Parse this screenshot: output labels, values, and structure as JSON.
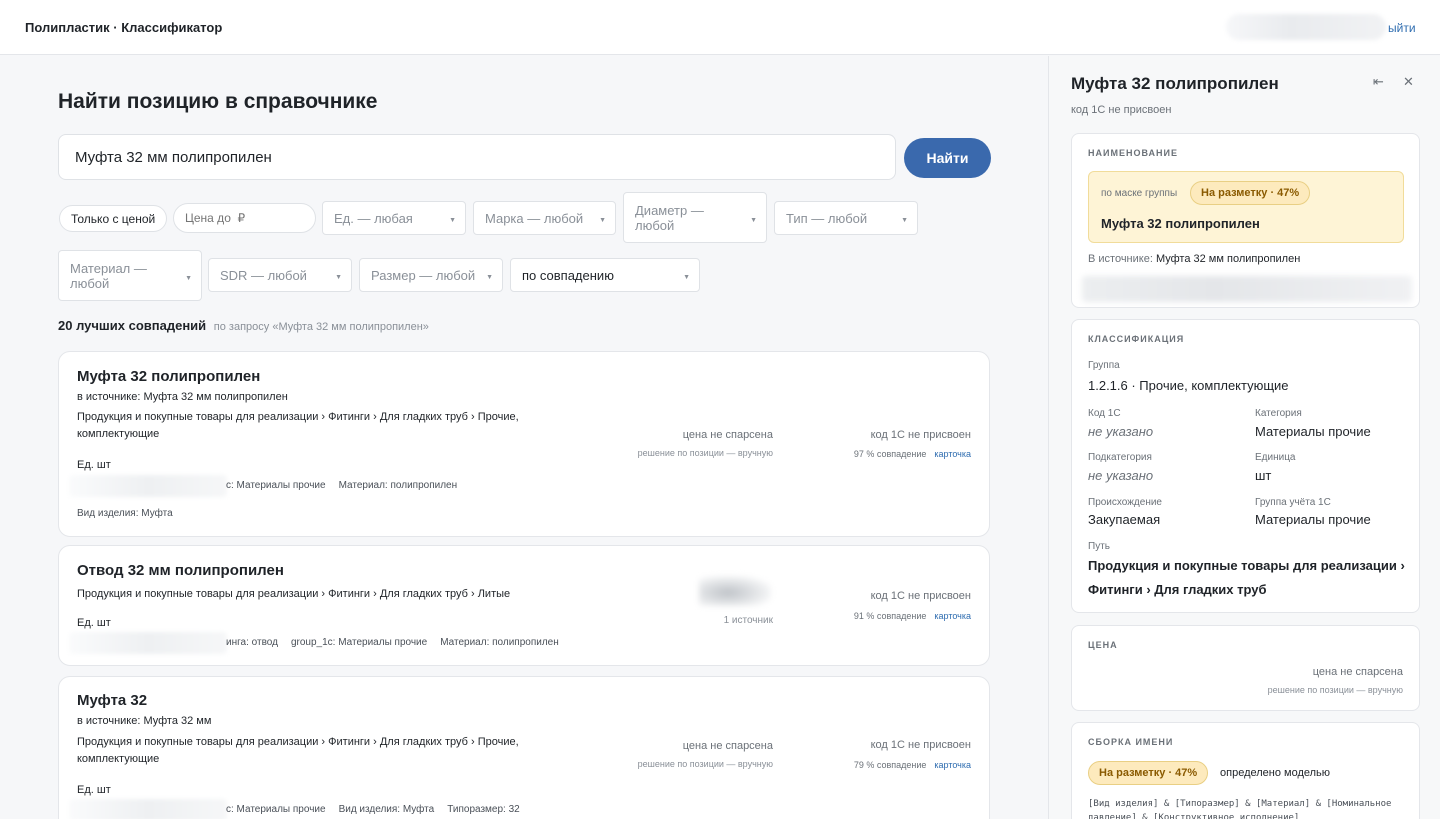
{
  "topbar": {
    "brand": "Полипластик · Классификатор",
    "logout": "ыйти"
  },
  "search": {
    "title": "Найти позицию в справочнике",
    "query": "Муфта 32 мм полипропилен",
    "button": "Найти"
  },
  "filters": {
    "only_with_price": "Только с ценой",
    "price_to_placeholder": "Цена до  ₽",
    "unit": "Ед. — любая",
    "brand": "Марка — любой",
    "diameter": "Диаметр — любой",
    "type": "Тип — любой",
    "material": "Материал — любой",
    "sdr": "SDR — любой",
    "size": "Размер — любой",
    "sort": "по совпадению"
  },
  "results": {
    "count_label": "20 лучших совпадений",
    "query_label": "по запросу «Муфта 32 мм полипропилен»",
    "items": [
      {
        "title": "Муфта 32 полипропилен",
        "source": "в источнике: Муфта 32 мм полипропилен",
        "path": "Продукция и покупные товары для реализации › Фитинги › Для гладких труб › Прочие, комплектующие",
        "unit": "Ед. шт",
        "attr1": "с: Материалы прочие",
        "attr2": "Материал: полипропилен",
        "attr3": "",
        "kind": "Вид изделия: Муфта",
        "price": "цена не спарсена",
        "decision": "решение по позиции — вручную",
        "code": "код 1С не присвоен",
        "match": "97 % совпадение",
        "link": "карточка"
      },
      {
        "title": "Отвод 32 мм полипропилен",
        "path": "Продукция и покупные товары для реализации › Фитинги › Для гладких труб › Литые",
        "unit": "Ед. шт",
        "attr1": "инга: отвод",
        "attr2": "group_1c: Материалы прочие",
        "attr3": "Материал: полипропилен",
        "sources": "1 источник",
        "code": "код 1С не присвоен",
        "match": "91 % совпадение",
        "link": "карточка"
      },
      {
        "title": "Муфта 32",
        "source": "в источнике: Муфта 32 мм",
        "path": "Продукция и покупные товары для реализации › Фитинги › Для гладких труб › Прочие, комплектующие",
        "unit": "Ед. шт",
        "attr1": "с: Материалы прочие",
        "attr2": "Вид изделия: Муфта",
        "attr3": "Типоразмер: 32",
        "price": "цена не спарсена",
        "decision": "решение по позиции — вручную",
        "code": "код 1С не присвоен",
        "match": "79 % совпадение",
        "link": "карточка"
      }
    ]
  },
  "panel": {
    "title": "Муфта 32 полипропилен",
    "subtitle": "код 1С не присвоен",
    "naming": {
      "section": "НАИМЕНОВАНИЕ",
      "mask": "по маске группы",
      "badge": "На разметку · 47%",
      "name": "Муфта 32 полипропилен",
      "source_label": "В источнике:",
      "source_value": "Муфта 32 мм полипропилен"
    },
    "classification": {
      "section": "КЛАССИФИКАЦИЯ",
      "group_label": "Группа",
      "group_value": "1.2.1.6 · Прочие, комплектующие",
      "code_label": "Код 1С",
      "code_value": "не указано",
      "category_label": "Категория",
      "category_value": "Материалы прочие",
      "subcategory_label": "Подкатегория",
      "subcategory_value": "не указано",
      "unit_label": "Единица",
      "unit_value": "шт",
      "origin_label": "Происхождение",
      "origin_value": "Закупаемая",
      "group1c_label": "Группа учёта 1С",
      "group1c_value": "Материалы прочие",
      "path_label": "Путь",
      "path_value": "Продукция и покупные товары для реализации › Фитинги › Для гладких труб"
    },
    "price": {
      "section": "ЦЕНА",
      "value": "цена не спарсена",
      "decision": "решение по позиции — вручную"
    },
    "assembly": {
      "section": "СБОРКА ИМЕНИ",
      "badge": "На разметку · 47%",
      "note": "определено моделью",
      "formula": "[Вид изделия] & [Типоразмер] & [Материал] & [Номинальное давление] & [Конструктивное исполнение]"
    }
  }
}
